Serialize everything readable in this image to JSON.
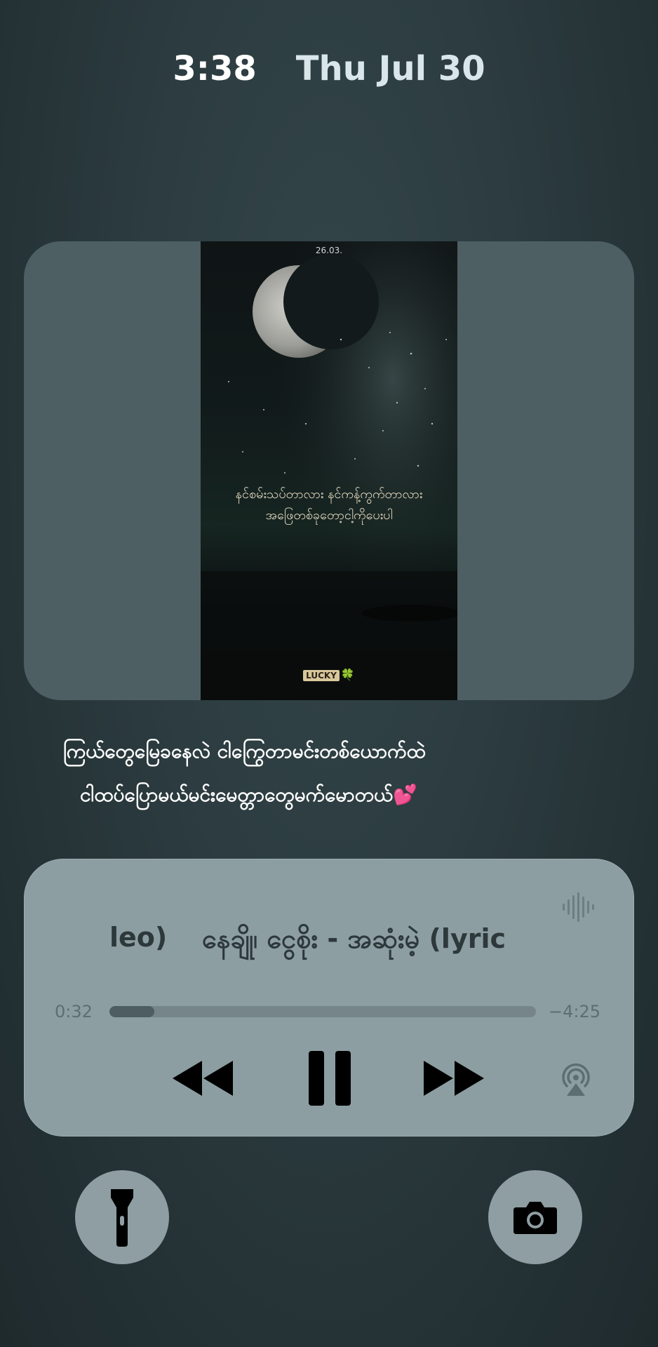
{
  "lockscreen": {
    "time": "3:38",
    "date": "Thu Jul 30"
  },
  "artwork": {
    "date_text": "26.03.",
    "text_line1": "နင်စမ်းသပ်တာလား နင်ကန့်ကွက်တာလား",
    "text_line2": "အဖြေတစ်ခုတော့ငါ့ကိုပေးပါ",
    "brand": "LUCKY",
    "brand_emoji": "🍀"
  },
  "caption": {
    "line1": "ကြယ်တွေမြေခနေလဲ ငါကြွေတာမင်းတစ်ယောက်ထဲ",
    "line2": "ငါထပ်ပြောမယ်မင်းမေတ္တာတွေမက်မောတယ်",
    "emoji": "💕"
  },
  "player": {
    "title_tail": "leo)",
    "title_head": "နေချို၊ ငွေစိုး - အဆုံးမဲ့ (lyric",
    "elapsed": "0:32",
    "remaining": "−4:25",
    "progress_fraction": 0.105
  },
  "icons": {
    "waveform": "waveform-icon",
    "rewind": "rewind-icon",
    "pause": "pause-icon",
    "forward": "fast-forward-icon",
    "airplay": "airplay-icon",
    "flashlight": "flashlight-icon",
    "camera": "camera-icon"
  }
}
